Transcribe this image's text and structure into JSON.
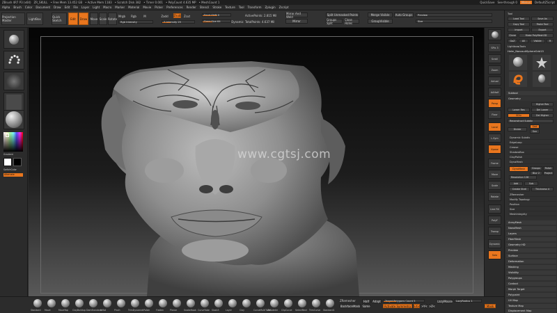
{
  "titlebar": {
    "app": "ZBrush 4R7 P3 (x64)",
    "doc": "ZR_SKULL",
    "info1": "• Free Mem 13.452 GB",
    "info2": "• Active Mem 1183",
    "info3": "• Scratch Disk 382",
    "info4": "• Timer 0.001",
    "info5": "• PolyCount 4.635  MP",
    "info6": "• MeshCount 1",
    "quicksave": "QuickSave",
    "seethrough": "See-through  0",
    "menus": "Menus",
    "default_script": "DefaultZScript"
  },
  "menubar": {
    "items": [
      "Alpha",
      "Brush",
      "Color",
      "Document",
      "Draw",
      "Edit",
      "File",
      "Layer",
      "Light",
      "Macro",
      "Marker",
      "Material",
      "Movie",
      "Picker",
      "Preferences",
      "Render",
      "Stencil",
      "Stroke",
      "Texture",
      "Tool",
      "Transform",
      "Zplugin",
      "Zscript"
    ]
  },
  "toolbar": {
    "projection": "Projection Master",
    "lightbox": "LightBox",
    "quicksketch": "Quick Sketch",
    "edit": "Edit",
    "draw": "Draw",
    "move": "Move",
    "scale": "Scale",
    "rotate": "Rotate",
    "mrgb": "Mrgb",
    "rgb": "Rgb",
    "m": "M",
    "zadd": "Zadd",
    "zsub": "Zsub",
    "zcut": "Zcut",
    "focal_shift": "Focal Shift 0",
    "draw_size": "Draw Size 64",
    "dynamic": "Dynamic",
    "rgb_intensity": "Rgb Intensity",
    "z_intensity": "Z Intensity 25",
    "active_points": "ActivePoints: 2.815 Mil",
    "total_points": "TotalPoints: 4.637 Mil",
    "mirror_weld": "Mirror And Weld",
    "mirror": "Mirror",
    "split_unmasked": "Split Unmasked Points",
    "groups_split": "Groups Split",
    "close_holes": "Close Holes",
    "merge_visible": "Merge Visible",
    "merge_similar": "Merge Similar",
    "group_visible": "GroupVisible",
    "auto_groups": "Auto Groups",
    "preview": "Preview",
    "smt": "Smt",
    "size": "Size"
  },
  "leftshelf": {
    "brush": "Standard",
    "stroke": "Dots",
    "alpha": "Alpha Off",
    "texture": "Texture Off",
    "material": "MatCap Gray",
    "gradient": "Gradient",
    "switch_color": "SwitchColor",
    "alternate": "Alternate",
    "colors": {
      "bg": "#2b2b2b",
      "accent": "#e9761e"
    }
  },
  "viewport": {
    "watermark": "www.cgtsj.com"
  },
  "rightshelf": {
    "buttons": [
      "BPR",
      "SPix 3",
      "Scroll",
      "Zoom",
      "Actual",
      "AAHalf",
      "Persp",
      "Floor",
      "Local",
      "L.Sym",
      "Xpose",
      "Frame",
      "Move",
      "Scale",
      "Rotate",
      "Line Fill",
      "PolyF",
      "Transp",
      "Dynamic",
      "Solo"
    ]
  },
  "tray": {
    "title": "Tool",
    "load_tool": "Load Tool",
    "save_as": "Save As",
    "copy_tool": "Copy Tool",
    "paste_tool": "Paste Tool",
    "import": "Import",
    "export": "Export",
    "clone": "Clone",
    "make_polymesh": "Make PolyMesh3D",
    "goz": "GoZ",
    "all": "All",
    "visible": "Visible",
    "r": "R",
    "lightbox_tools": "Lightbox▸Tools",
    "current_tool": "Helm_NanosuitSphereGrid15",
    "subtool": "Subtool",
    "geometry": "Geometry",
    "higher_res": "Higher Res",
    "lower_res": "Lower Res",
    "sdiv": "SDiv",
    "del_lower": "Del Lower",
    "del_higher": "Del Higher",
    "reconstruct_subdiv": "Reconstruct Subdiv",
    "divide": "Divide",
    "smt": "Smt",
    "suv": "Suv",
    "dynamic_subdiv": "Dynamic Subdiv",
    "edge_loop": "EdgeLoop",
    "crease": "Crease",
    "shadowbox": "ShadowBox",
    "claypolish": "ClayPolish",
    "dynamesh": "DynaMesh",
    "groups": "Groups",
    "polish": "Polish",
    "blur": "Blur 2",
    "project": "Project",
    "resolution": "Resolution 128",
    "add": "Add",
    "sub": "Sub",
    "create_shell": "Create Shell",
    "thickness": "Thickness 4",
    "zremesher": "ZRemesher",
    "modify_topology": "Modify Topology",
    "position": "Position",
    "size": "Size",
    "meshintegrity": "MeshIntegrity",
    "sections": [
      "ArrayMesh",
      "NanoMesh",
      "Layers",
      "FiberMesh",
      "Geometry HD",
      "Preview",
      "Surface",
      "Deformation",
      "Masking",
      "Visibility",
      "Polygroups",
      "Contact",
      "Morph Target",
      "Polypaint",
      "UV Map",
      "Texture Map",
      "Displacement Map",
      "Normal Map"
    ]
  },
  "bottombar": {
    "brushes": [
      "Standard",
      "Move",
      "MoveTop",
      "ClayBuildup",
      "DamStandard",
      "Inflat",
      "Pinch",
      "TrimDynamic",
      "hPolish",
      "Flatten",
      "Planar",
      "SnakeHook",
      "CurveTube",
      "Slash3",
      "Layer",
      "Clay",
      "CurveMultiTube",
      "ZModeler",
      "ClipCurve",
      "SelectRect",
      "TrimCurve",
      "Standard1"
    ],
    "zremesher": "ZRemesher",
    "backface": "BackfaceMask",
    "half": "Half",
    "same": "Same",
    "adapt": "Adapt",
    "target_polys": "Target Polygons Count 5",
    "activate_sym": "Activate Symmetry",
    "sym_x": ">X<",
    "sym_y": ">Y<",
    "sym_z": ">Z<",
    "lazy_mouse": "LazyMouse",
    "lazy_radius": "LazyRadius 1",
    "mask": "Mask"
  }
}
